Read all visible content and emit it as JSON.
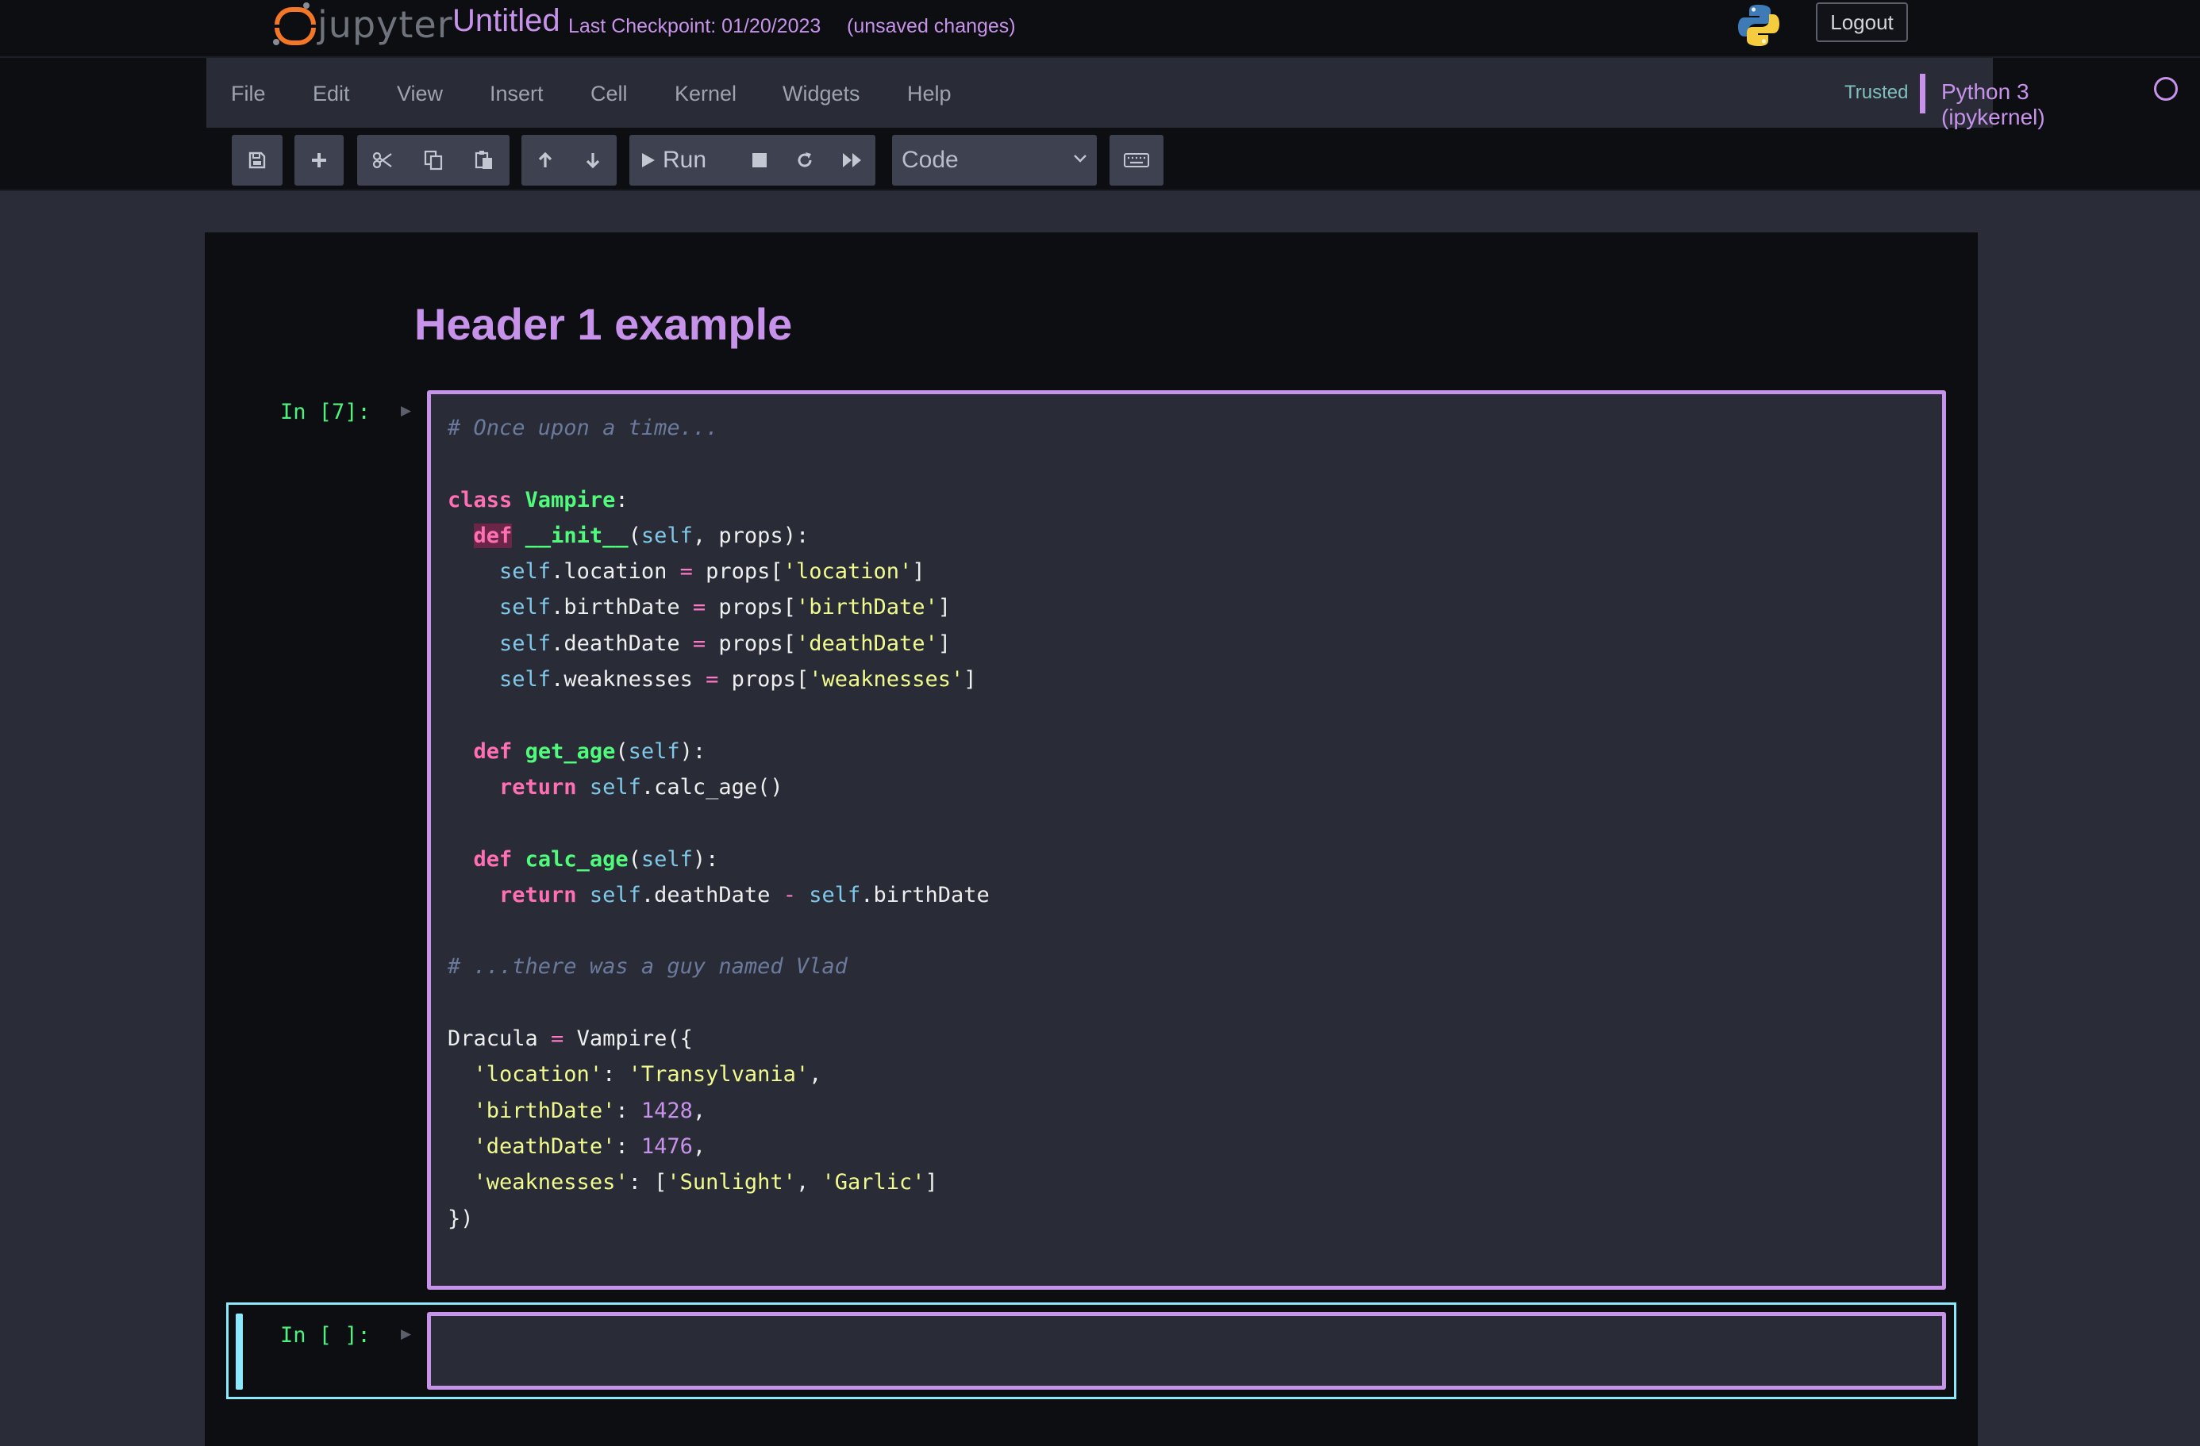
{
  "header": {
    "logo_text": "jupyter",
    "notebook_title": "Untitled",
    "checkpoint": "Last Checkpoint: 01/20/2023",
    "save_status": "(unsaved changes)",
    "logout_label": "Logout"
  },
  "menubar": {
    "items": [
      "File",
      "Edit",
      "View",
      "Insert",
      "Cell",
      "Kernel",
      "Widgets",
      "Help"
    ],
    "trusted_label": "Trusted",
    "kernel_name": "Python 3 (ipykernel)"
  },
  "toolbar": {
    "icons": [
      "save-icon",
      "plus-icon",
      "cut-icon",
      "copy-icon",
      "paste-icon",
      "arrow-up-icon",
      "arrow-down-icon",
      "play-icon",
      "stop-icon",
      "restart-icon",
      "fast-forward-icon",
      "keyboard-icon"
    ],
    "run_label": "Run",
    "cell_type": "Code"
  },
  "notebook": {
    "heading": "Header 1 example",
    "code_prompt": "In [7]:",
    "empty_prompt": "In [ ]:",
    "code_lines": [
      "# Once upon a time...",
      "",
      "class Vampire:",
      "  def __init__(self, props):",
      "    self.location = props['location']",
      "    self.birthDate = props['birthDate']",
      "    self.deathDate = props['deathDate']",
      "    self.weaknesses = props['weaknesses']",
      "",
      "  def get_age(self):",
      "    return self.calc_age()",
      "",
      "  def calc_age(self):",
      "    return self.deathDate - self.birthDate",
      "",
      "# ...there was a guy named Vlad",
      "",
      "Dracula = Vampire({",
      "  'location': 'Transylvania',",
      "  'birthDate': 1428,",
      "  'deathDate': 1476,",
      "  'weaknesses': ['Sunlight', 'Garlic']",
      "})"
    ]
  },
  "colors": {
    "accent": "#c792ea",
    "logo_orange": "#f37726",
    "prompt_green": "#4ef07f",
    "selected_cell": "#8be9fd",
    "background": "#0c0e12"
  }
}
